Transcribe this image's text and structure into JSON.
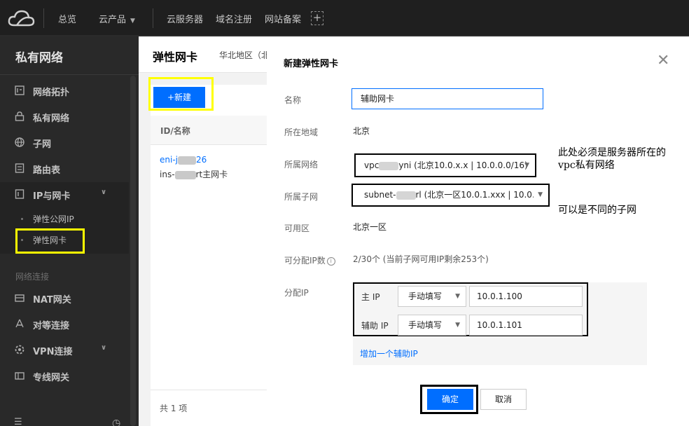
{
  "topbar": {
    "logo_icon": "cloud-icon",
    "nav": [
      "总览",
      "云产品",
      "云服务器",
      "域名注册",
      "网站备案"
    ],
    "plus_icon": "add-icon"
  },
  "sidebar": {
    "title": "私有网络",
    "items": [
      {
        "label": "网络拓扑",
        "icon": "topology-icon"
      },
      {
        "label": "私有网络",
        "icon": "lock-icon"
      },
      {
        "label": "子网",
        "icon": "globe-icon"
      },
      {
        "label": "路由表",
        "icon": "route-table-icon"
      },
      {
        "label": "IP与网卡",
        "icon": "ip-card-icon"
      }
    ],
    "sub_items": [
      "弹性公网IP",
      "弹性网卡"
    ],
    "section_label": "网络连接",
    "section_items": [
      {
        "label": "NAT网关",
        "icon": "nat-icon"
      },
      {
        "label": "对等连接",
        "icon": "peering-icon"
      },
      {
        "label": "VPN连接",
        "icon": "vpn-icon"
      },
      {
        "label": "专线网关",
        "icon": "dedicated-line-icon"
      }
    ]
  },
  "main": {
    "title": "弹性网卡",
    "region": "华北地区（北",
    "new_button": "+新建",
    "column_header": "ID/名称",
    "row": {
      "id_prefix": "eni-j",
      "id_suffix": "26",
      "name_prefix": "ins-",
      "name_suffix": "rt主网卡"
    },
    "total": "共 1 项"
  },
  "dialog": {
    "title": "新建弹性网卡",
    "labels": {
      "name": "名称",
      "region": "所在地域",
      "vpc": "所属网络",
      "subnet": "所属子网",
      "zone": "可用区",
      "ip_count": "可分配IP数",
      "assign_ip": "分配IP"
    },
    "name_value": "辅助网卡",
    "region_value": "北京",
    "vpc_prefix": "vpc",
    "vpc_suffix": "yni (北京10.0.x.x | 10.0.0.0/16)",
    "subnet_prefix": "subnet-",
    "subnet_suffix": "rl (北京一区10.0.1.xxx | 10.0.1.",
    "zone_value": "北京一区",
    "ip_count_value": "2/30个 (当前子网可用IP剩余253个)",
    "ip_rows": [
      {
        "label": "主 IP",
        "mode": "手动填写",
        "ip": "10.0.1.100"
      },
      {
        "label": "辅助 IP",
        "mode": "手动填写",
        "ip": "10.0.1.101"
      }
    ],
    "add_ip_link": "增加一个辅助IP",
    "ok_button": "确定",
    "cancel_button": "取消"
  },
  "annotations": {
    "vpc_note_line1": "此处必须是服务器所在的",
    "vpc_note_line2": "vpc私有网络",
    "subnet_note": "可以是不同的子网"
  }
}
